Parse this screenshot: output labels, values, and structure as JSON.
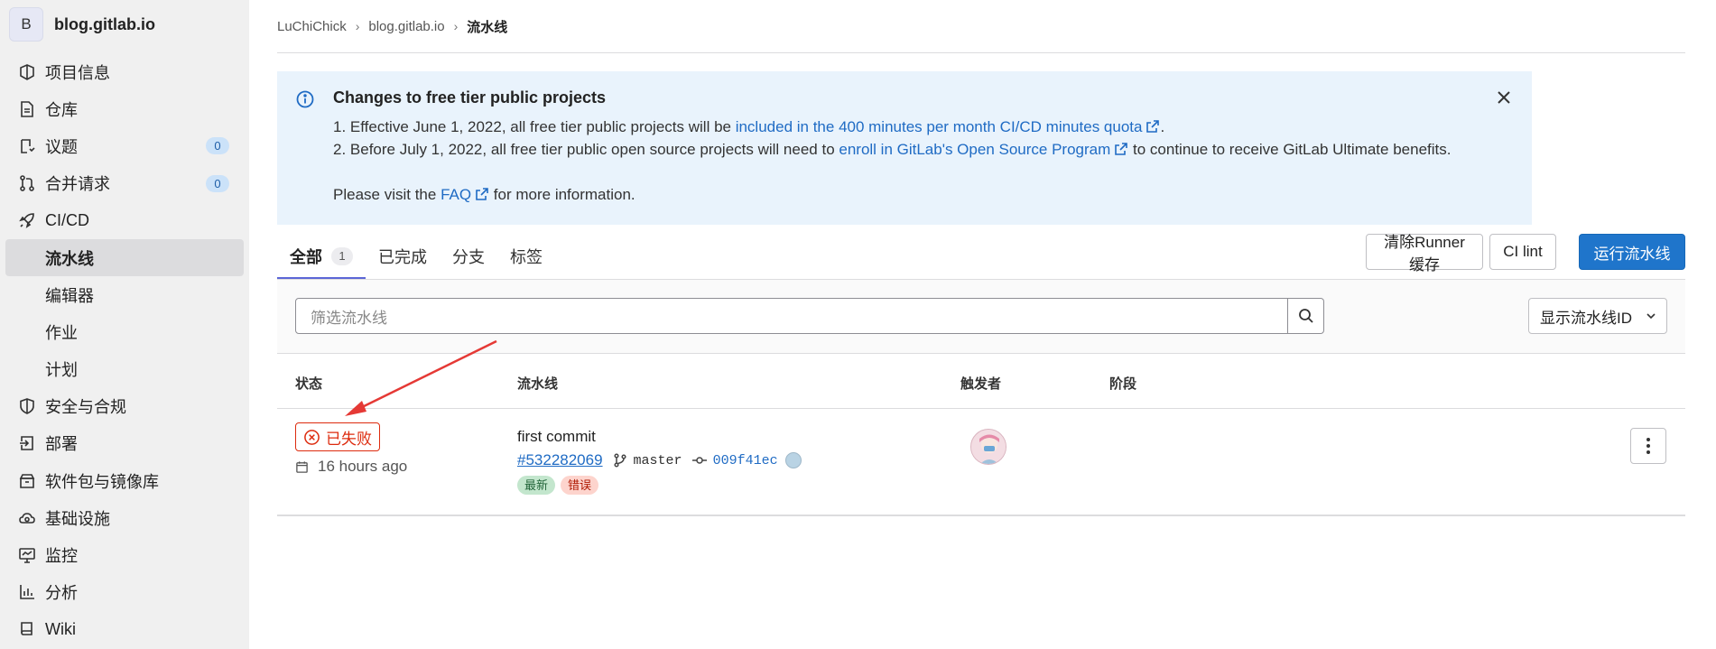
{
  "sidebar": {
    "project_initial": "B",
    "project_name": "blog.gitlab.io",
    "items": [
      {
        "label": "项目信息",
        "icon": "project-icon"
      },
      {
        "label": "仓库",
        "icon": "document-icon"
      },
      {
        "label": "议题",
        "icon": "issues-icon",
        "count": "0"
      },
      {
        "label": "合并请求",
        "icon": "merge-request-icon",
        "count": "0"
      },
      {
        "label": "CI/CD",
        "icon": "rocket-icon"
      },
      {
        "label": "流水线"
      },
      {
        "label": "编辑器"
      },
      {
        "label": "作业"
      },
      {
        "label": "计划"
      },
      {
        "label": "安全与合规",
        "icon": "shield-icon"
      },
      {
        "label": "部署",
        "icon": "deploy-icon"
      },
      {
        "label": "软件包与镜像库",
        "icon": "package-icon"
      },
      {
        "label": "基础设施",
        "icon": "cloud-gear-icon"
      },
      {
        "label": "监控",
        "icon": "monitor-icon"
      },
      {
        "label": "分析",
        "icon": "chart-icon"
      },
      {
        "label": "Wiki",
        "icon": "book-icon"
      }
    ]
  },
  "breadcrumb": [
    "LuChiChick",
    "blog.gitlab.io",
    "流水线"
  ],
  "alert": {
    "title": "Changes to free tier public projects",
    "line1_prefix": "1. Effective June 1, 2022, all free tier public projects will be ",
    "line1_link": "included in the 400 minutes per month CI/CD minutes quota",
    "line1_suffix": ".",
    "line2_prefix": "2. Before July 1, 2022, all free tier public open source projects will need to ",
    "line2_link": "enroll in GitLab's Open Source Program",
    "line2_suffix": " to continue to receive GitLab Ultimate benefits.",
    "line3_prefix": "Please visit the ",
    "line3_link": "FAQ",
    "line3_suffix": " for more information."
  },
  "tabs": [
    {
      "label": "全部",
      "count": "1"
    },
    {
      "label": "已完成"
    },
    {
      "label": "分支"
    },
    {
      "label": "标签"
    }
  ],
  "buttons": {
    "clear_cache": "清除Runner缓存",
    "ci_lint": "CI lint",
    "run_pipeline": "运行流水线"
  },
  "filter": {
    "placeholder": "筛选流水线",
    "display_select": "显示流水线ID"
  },
  "table": {
    "headers": [
      "状态",
      "流水线",
      "触发者",
      "阶段"
    ],
    "row": {
      "status": "已失败",
      "time": "16 hours ago",
      "commit_title": "first commit",
      "pipeline_id": "#532282069",
      "branch": "master",
      "sha": "009f41ec",
      "tags": [
        "最新",
        "错误"
      ]
    }
  },
  "colors": {
    "accent": "#1f75cb",
    "failed": "#dd2b0e",
    "annotation_arrow": "#e53935"
  }
}
